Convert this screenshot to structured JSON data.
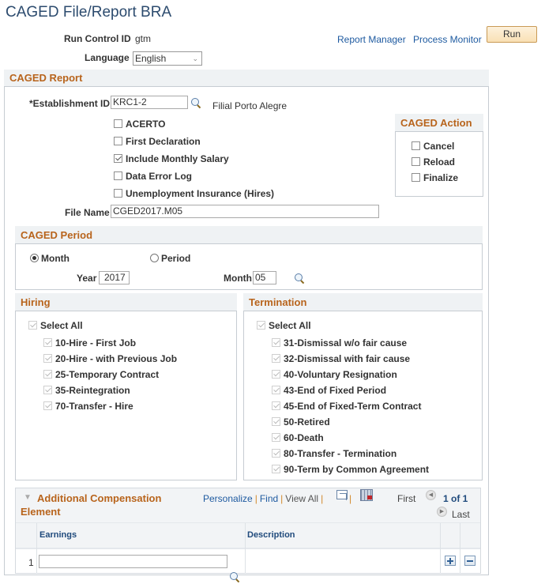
{
  "page": {
    "title": "CAGED File/Report BRA"
  },
  "header": {
    "run_control_label": "Run Control ID",
    "run_control_value": "gtm",
    "language_label": "Language",
    "language_value": "English",
    "report_manager": "Report Manager",
    "process_monitor": "Process Monitor",
    "run_button": "Run"
  },
  "caged_report": {
    "title": "CAGED Report",
    "establishment_label": "*Establishment ID",
    "establishment_value": "KRC1-2",
    "establishment_desc": "Filial Porto Alegre",
    "options": [
      {
        "label": "ACERTO",
        "checked": false
      },
      {
        "label": "First Declaration",
        "checked": false
      },
      {
        "label": "Include Monthly Salary",
        "checked": true
      },
      {
        "label": "Data Error Log",
        "checked": false
      },
      {
        "label": "Unemployment Insurance (Hires)",
        "checked": false
      }
    ],
    "file_name_label": "File Name",
    "file_name_value": "CGED2017.M05",
    "action": {
      "title": "CAGED Action",
      "items": [
        {
          "label": "Cancel",
          "checked": false
        },
        {
          "label": "Reload",
          "checked": false
        },
        {
          "label": "Finalize",
          "checked": false
        }
      ]
    }
  },
  "caged_period": {
    "title": "CAGED Period",
    "radio_month": "Month",
    "radio_period": "Period",
    "selected": "Month",
    "year_label": "Year",
    "year_value": "2017",
    "month_label": "Month",
    "month_value": "05"
  },
  "hiring": {
    "title": "Hiring",
    "select_all": "Select All",
    "items": [
      "10-Hire - First Job",
      "20-Hire - with Previous Job",
      "25-Temporary Contract",
      "35-Reintegration",
      "70-Transfer - Hire"
    ]
  },
  "termination": {
    "title": "Termination",
    "select_all": "Select All",
    "items": [
      "31-Dismissal w/o fair cause",
      "32-Dismissal with fair cause",
      "40-Voluntary Resignation",
      "43-End of Fixed Period",
      "45-End of Fixed-Term Contract",
      "50-Retired",
      "60-Death",
      "80-Transfer - Termination",
      "90-Term by Common Agreement"
    ]
  },
  "compensation": {
    "title_line1": "Additional Compensation",
    "title_line2": "Element",
    "personalize": "Personalize",
    "find": "Find",
    "view_all": "View All",
    "first": "First",
    "page_info": "1 of 1",
    "last": "Last",
    "columns": [
      "Earnings",
      "Description"
    ],
    "rows": [
      {
        "num": "1",
        "earnings": "",
        "description": ""
      }
    ]
  }
}
